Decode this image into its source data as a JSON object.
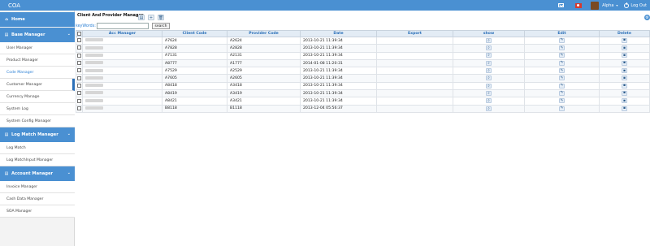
{
  "app": {
    "title": "COA"
  },
  "topbar": {
    "user": "Alpha",
    "logout": "Log Out"
  },
  "sidebar": {
    "home": "Home",
    "sections": [
      {
        "title": "Base Manager",
        "items": [
          "User Manager",
          "Product Manager",
          "Code Manager",
          "Customer Manager",
          "Currency Manage",
          "System Log",
          "System Config Manager"
        ]
      },
      {
        "title": "Log Match Manager",
        "items": [
          "Log Match",
          "Log MatchInput Manager"
        ]
      },
      {
        "title": "Account Manager",
        "items": [
          "Invoice Manager",
          "Cash Data Manager",
          "SOA Manager"
        ]
      }
    ]
  },
  "main": {
    "title": "Client And Provider Manager",
    "keyword_label": "keyWords:",
    "keyword_value": "",
    "search_label": "search",
    "columns": [
      "Acc Manager",
      "Client Code",
      "Provider Code",
      "Date",
      "Export",
      "show",
      "Edit",
      "Delete"
    ],
    "rows": [
      {
        "acc": "",
        "client": "A7624",
        "provider": "A2624",
        "date": "2013-10-21 11:39:34",
        "export": ""
      },
      {
        "acc": "",
        "client": "A7828",
        "provider": "A2828",
        "date": "2013-10-21 11:39:34",
        "export": ""
      },
      {
        "acc": "",
        "client": "A7131",
        "provider": "A2131",
        "date": "2013-10-21 11:39:34",
        "export": ""
      },
      {
        "acc": "",
        "client": "A8777",
        "provider": "A1777",
        "date": "2014-01-08 11:20:31",
        "export": ""
      },
      {
        "acc": "",
        "client": "A7529",
        "provider": "A2529",
        "date": "2013-10-21 11:39:34",
        "export": ""
      },
      {
        "acc": "",
        "client": "A7605",
        "provider": "A2605",
        "date": "2013-10-21 11:39:34",
        "export": ""
      },
      {
        "acc": "",
        "client": "A8418",
        "provider": "A3418",
        "date": "2013-10-21 11:39:34",
        "export": ""
      },
      {
        "acc": "",
        "client": "A8419",
        "provider": "A3419",
        "date": "2013-10-21 11:39:34",
        "export": ""
      },
      {
        "acc": "",
        "client": "A8421",
        "provider": "A3421",
        "date": "2013-10-21 11:39:34",
        "export": ""
      },
      {
        "acc": "",
        "client": "B8118",
        "provider": "B1118",
        "date": "2013-12-04 05:56:37",
        "export": ""
      }
    ]
  },
  "icons": {
    "home": "home-icon",
    "list": "list-icon",
    "add": "plus-icon",
    "delete": "trash-icon",
    "show": "magnifier-icon",
    "edit": "pencil-icon",
    "gear": "gear-icon"
  },
  "colors": {
    "brand": "#4a90d2",
    "accent_text": "#2a7fd4"
  }
}
